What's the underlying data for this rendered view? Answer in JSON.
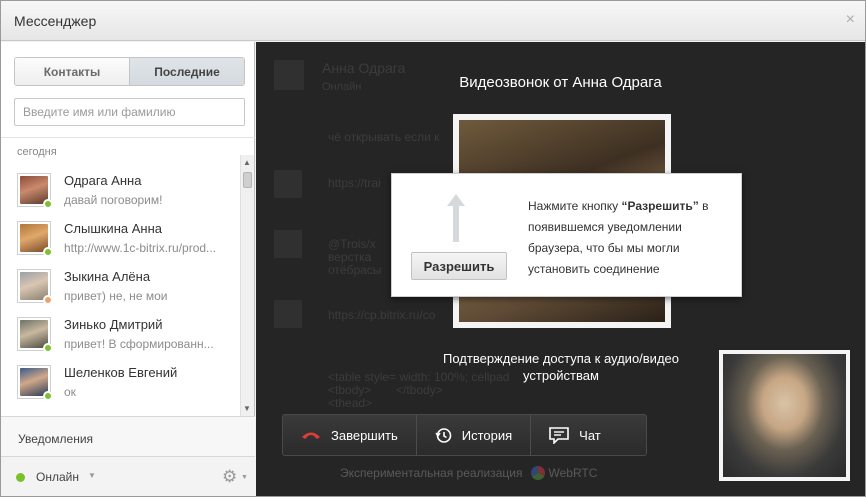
{
  "window": {
    "title": "Мессенджер",
    "close_glyph": "×"
  },
  "sidebar": {
    "tabs": [
      {
        "label": "Контакты"
      },
      {
        "label": "Последние"
      }
    ],
    "active_tab": "Последние",
    "search_placeholder": "Введите имя или фамилию",
    "group_label": "сегодня",
    "items": [
      {
        "name": "Одрага Анна",
        "message": "давай поговорим!",
        "status_color": "#7ac22c"
      },
      {
        "name": "Слышкина Анна",
        "message": "http://www.1c-bitrix.ru/prod...",
        "status_color": "#7ac22c"
      },
      {
        "name": "Зыкина Алёна",
        "message": "привет) не, не мои",
        "status_color": "#f1a06a"
      },
      {
        "name": "Зинько Дмитрий",
        "message": "привет! В сформированн...",
        "status_color": "#7ac22c"
      },
      {
        "name": "Шеленков Евгений",
        "message": "ок",
        "status_color": "#7ac22c"
      }
    ],
    "notifications_label": "Уведомления",
    "status_label": "Онлайн",
    "status_color": "#79c12b"
  },
  "call": {
    "title": "Видеозвонок от Анна Одрага",
    "allow_button": "Разрешить",
    "prompt_parts": [
      "Нажмите кнопку ",
      "“Разрешить”",
      " в появившемся уведомлении браузера, что бы мы могли установить соединение"
    ],
    "confirm_text": "Подтверждение доступа к аудио/видео устройствам",
    "buttons": [
      {
        "label": "Завершить",
        "icon": "hangup-icon"
      },
      {
        "label": "История",
        "icon": "history-icon"
      },
      {
        "label": "Чат",
        "icon": "chat-icon"
      }
    ],
    "experimental_label": "Экспериментальная реализация",
    "webrtc_label": "WebRTC"
  },
  "background_chat": {
    "name": "Анна Одрага",
    "subtitle": "Онлайн",
    "lines": [
      "чё открывать если к",
      "https://trai",
      "@Trois/x",
      "верстка",
      "отёбрасы",
      "https://cp.bitrix.ru/co",
      "<table style= width: 100%; cellpad",
      "<tbody>",
      "</tbody>",
      "<thead>"
    ]
  },
  "colors": {
    "accent": "#7ac22c",
    "hangup": "#e13c3c",
    "dark_bg": "#252525"
  }
}
